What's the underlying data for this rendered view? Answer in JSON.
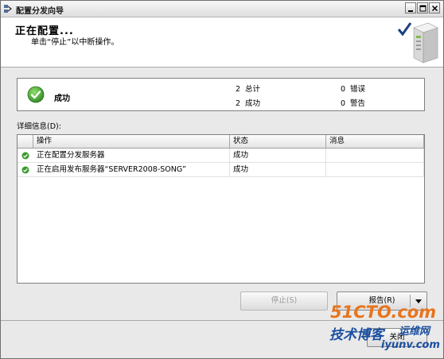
{
  "window": {
    "title": "配置分发向导"
  },
  "header": {
    "title": "正在配置...",
    "subtitle": "单击“停止”以中断操作。"
  },
  "status": {
    "text": "成功",
    "stats": [
      {
        "count": "2",
        "label": "总计"
      },
      {
        "count": "0",
        "label": "错误"
      },
      {
        "count": "2",
        "label": "成功"
      },
      {
        "count": "0",
        "label": "警告"
      }
    ]
  },
  "details": {
    "label": "详细信息(D):",
    "columns": [
      "操作",
      "状态",
      "消息"
    ],
    "rows": [
      {
        "action": "正在配置分发服务器",
        "status": "成功",
        "message": ""
      },
      {
        "action": "正在启用发布服务器“SERVER2008-SONG”",
        "status": "成功",
        "message": ""
      }
    ]
  },
  "buttons": {
    "stop": "停止(S)",
    "report": "报告(R)",
    "close": "关闭"
  },
  "watermark": {
    "brand": "51CTO.com",
    "tagline": "技术博客",
    "brand2": "运维网",
    "url": "iyunv.com"
  },
  "colors": {
    "success_green": "#3a9a2c",
    "header_bg": "#ffffff",
    "watermark_orange": "#e8741b"
  }
}
